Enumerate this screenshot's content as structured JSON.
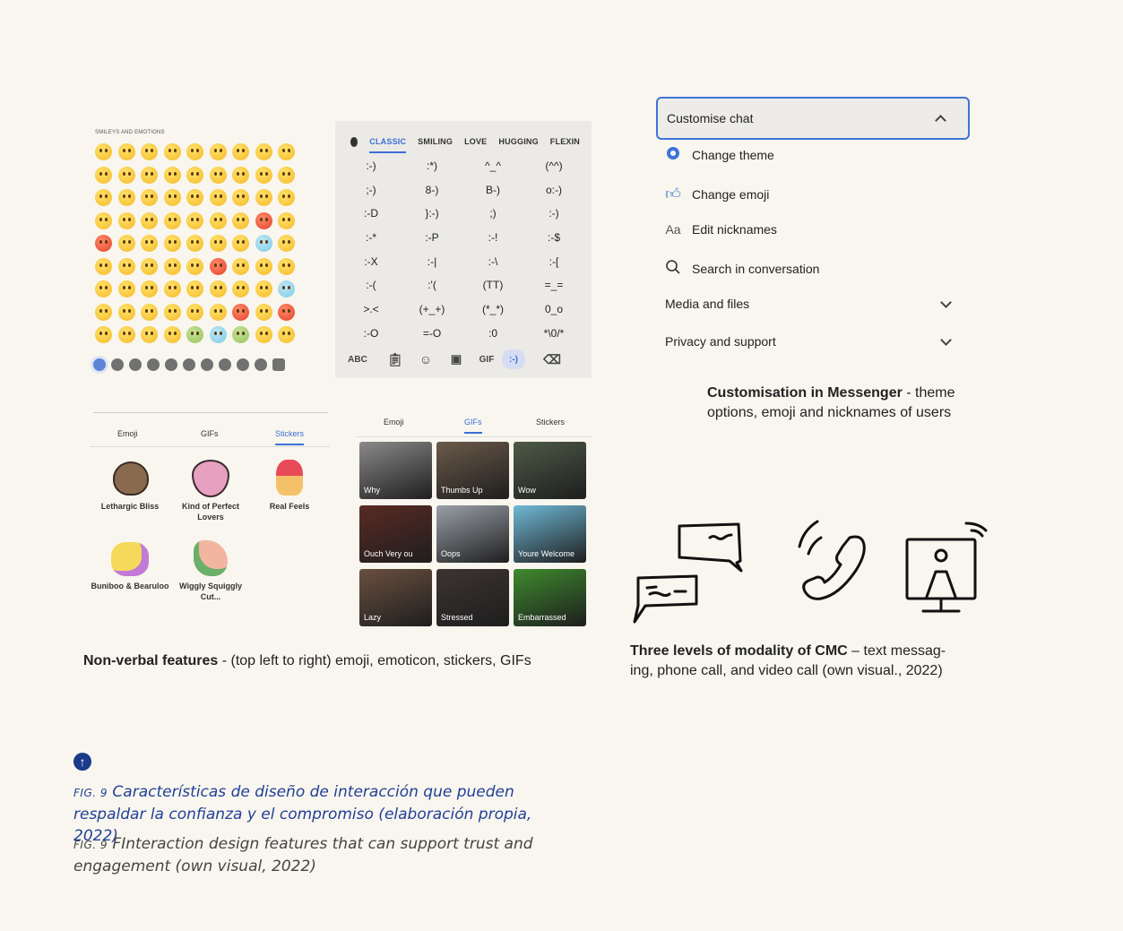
{
  "emoji_panel": {
    "heading": "SMILEYS AND EMOTIONS",
    "rows": 9,
    "cols": 9
  },
  "emoticon_panel": {
    "tabs": [
      "CLASSIC",
      "SMILING",
      "LOVE",
      "HUGGING",
      "FLEXIN"
    ],
    "active_tab": "CLASSIC",
    "emoticons": [
      ":-)",
      ":*)",
      "^_^",
      "(^^)",
      ";-)",
      "8-)",
      "B-)",
      "o:-)",
      ":-D",
      "}:-)",
      ";)",
      ":-)",
      ":-*",
      ":-P",
      ":-!",
      ":-$",
      ":-X",
      ":-|",
      ":-\\",
      ":-[",
      ":-(",
      ":'(",
      "(TT)",
      "=_=",
      ">.<",
      "(+_+)",
      "(*_*)",
      "0_o",
      ":-O",
      "=-O",
      ":0",
      "*\\0/*"
    ],
    "bar": {
      "abc": "ABC",
      "gif": "GIF",
      "emoticon": ":-)"
    }
  },
  "stickers_panel": {
    "tabs": [
      "Emoji",
      "GIFs",
      "Stickers"
    ],
    "active_tab": "Stickers",
    "stickers": [
      {
        "label": "Lethargic Bliss"
      },
      {
        "label": "Kind of Perfect Lovers"
      },
      {
        "label": "Real Feels"
      },
      {
        "label": "Buniboo & Bearuloo"
      },
      {
        "label": "Wiggly Squiggly Cut..."
      }
    ]
  },
  "gif_panel": {
    "tabs": [
      "Emoji",
      "GIFs",
      "Stickers"
    ],
    "active_tab": "GIFs",
    "gifs": [
      {
        "label": "Why",
        "color": "#8a8a8a"
      },
      {
        "label": "Thumbs Up",
        "color": "#6b5a4a"
      },
      {
        "label": "Wow",
        "color": "#4e5a46"
      },
      {
        "label": "Ouch    Very ou",
        "color": "#5a2a24"
      },
      {
        "label": "Oops",
        "color": "#9aa0a8"
      },
      {
        "label": "Youre Welcome",
        "color": "#6fb9d6"
      },
      {
        "label": "Lazy",
        "color": "#6a5040"
      },
      {
        "label": "Stressed",
        "color": "#3c3432"
      },
      {
        "label": "Embarrassed",
        "color": "#3e8a2e"
      }
    ]
  },
  "messenger": {
    "header": "Customise chat",
    "items": [
      {
        "label": "Change theme",
        "icon": "theme-dot-icon"
      },
      {
        "label": "Change emoji",
        "icon": "thumbs-up-icon"
      },
      {
        "label": "Edit nicknames",
        "icon": "font-aa-icon",
        "glyph": "Aa"
      },
      {
        "label": "Search in conversation",
        "icon": "search-icon"
      },
      {
        "label": "Media and files",
        "icon": "chevron-down-icon"
      },
      {
        "label": "Privacy and support",
        "icon": "chevron-down-icon"
      }
    ],
    "accent": "#3e74d6"
  },
  "captions": {
    "messenger_bold": "Customisation in Messenger",
    "messenger_rest_1": " - theme",
    "messenger_line2": "options, emoji and nicknames of users",
    "nonverbal_bold": "Non-verbal features",
    "nonverbal_rest": " - (top left to right) emoji, emoticon, stickers, GIFs",
    "modality_bold": "Three levels of modality of CMC",
    "modality_rest_1": " – text messag-",
    "modality_line2": "ing, phone call, and video call (own visual., 2022)"
  },
  "figure": {
    "es_prefix": "FIG. 9",
    "es_line1": " Características de diseño de interacción que pueden",
    "es_line2": "respaldar la confianza y el compromiso (elaboración propia, 2022)",
    "en_prefix": "FIG. 9",
    "en_line1": " FInteraction design features that can support trust and",
    "en_line2": "engagement (own visual, 2022)",
    "accent": "#1a3a8a"
  }
}
